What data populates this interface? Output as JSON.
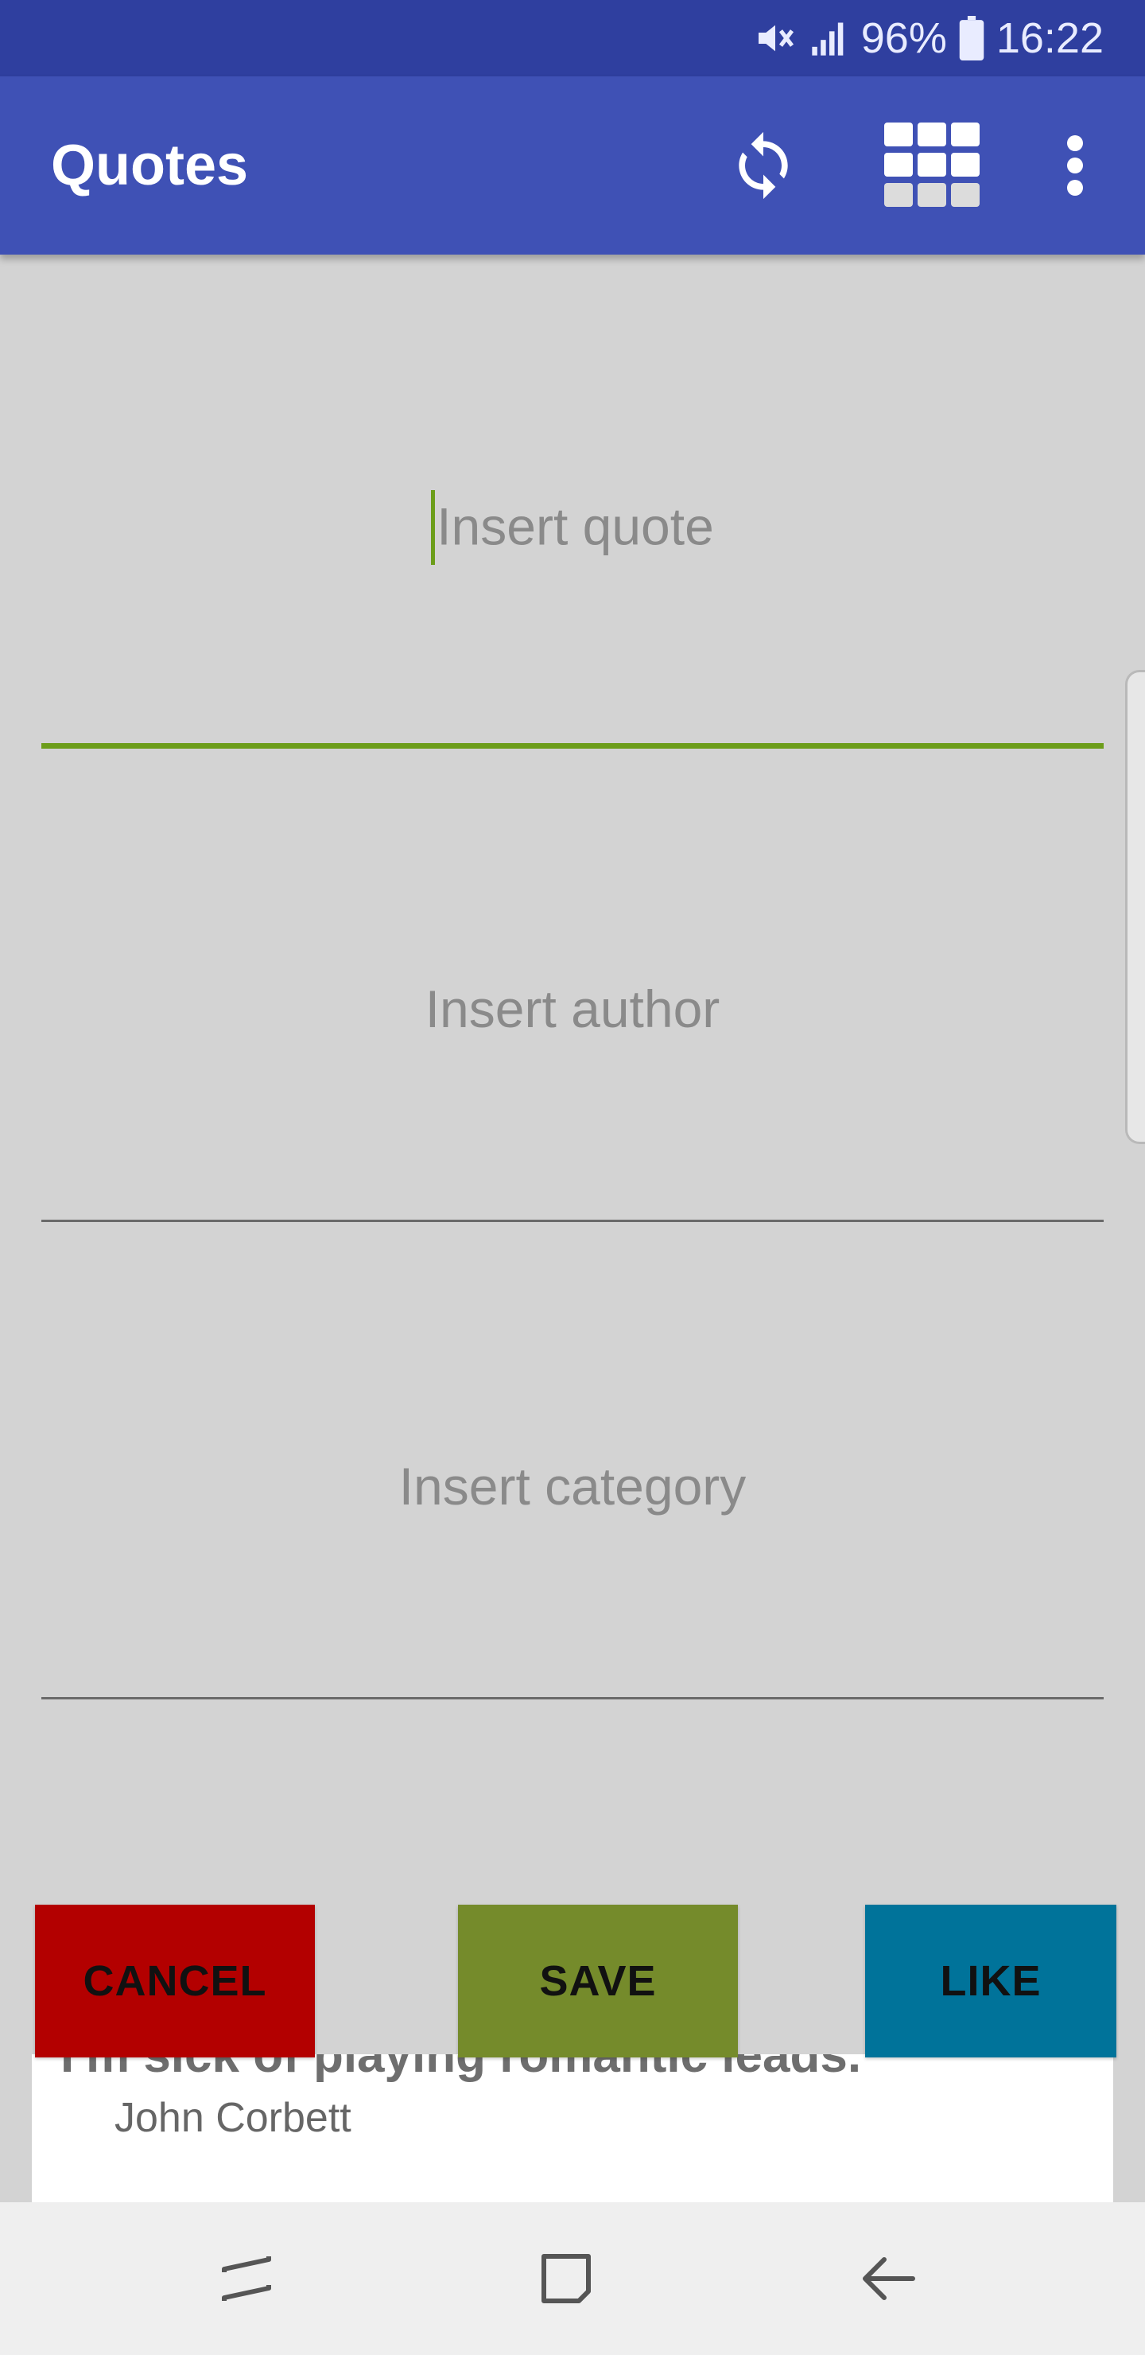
{
  "status_bar": {
    "battery": "96%",
    "time": "16:22",
    "icons": [
      "mute-icon",
      "signal-icon",
      "battery-icon"
    ]
  },
  "app_bar": {
    "title": "Quotes",
    "actions": [
      "refresh-icon",
      "grid-icon",
      "more-vert-icon"
    ],
    "color": "#3f51b5"
  },
  "form": {
    "quote_placeholder": "Insert quote",
    "author_placeholder": "Insert author",
    "category_placeholder": "Insert category",
    "active_field": "quote",
    "accent_color": "#6c9d1a"
  },
  "quote_card": {
    "text": "I'm sick of playing romantic leads.",
    "author": "John Corbett"
  },
  "actions": {
    "cancel_label": "CANCEL",
    "save_label": "SAVE",
    "like_label": "LIKE",
    "cancel_color": "#b30000",
    "save_color": "#758b2b",
    "like_color": "#00739a"
  },
  "nav_bar": {
    "buttons": [
      "recent-apps-icon",
      "home-icon",
      "back-icon"
    ]
  }
}
